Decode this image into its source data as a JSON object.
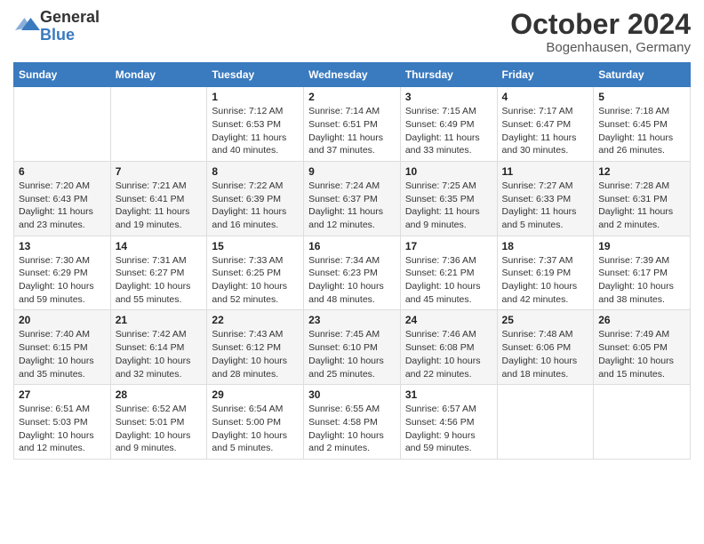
{
  "logo": {
    "general": "General",
    "blue": "Blue"
  },
  "title": "October 2024",
  "subtitle": "Bogenhausen, Germany",
  "days_of_week": [
    "Sunday",
    "Monday",
    "Tuesday",
    "Wednesday",
    "Thursday",
    "Friday",
    "Saturday"
  ],
  "weeks": [
    [
      {
        "day": "",
        "sunrise": "",
        "sunset": "",
        "daylight": ""
      },
      {
        "day": "",
        "sunrise": "",
        "sunset": "",
        "daylight": ""
      },
      {
        "day": "1",
        "sunrise": "Sunrise: 7:12 AM",
        "sunset": "Sunset: 6:53 PM",
        "daylight": "Daylight: 11 hours and 40 minutes."
      },
      {
        "day": "2",
        "sunrise": "Sunrise: 7:14 AM",
        "sunset": "Sunset: 6:51 PM",
        "daylight": "Daylight: 11 hours and 37 minutes."
      },
      {
        "day": "3",
        "sunrise": "Sunrise: 7:15 AM",
        "sunset": "Sunset: 6:49 PM",
        "daylight": "Daylight: 11 hours and 33 minutes."
      },
      {
        "day": "4",
        "sunrise": "Sunrise: 7:17 AM",
        "sunset": "Sunset: 6:47 PM",
        "daylight": "Daylight: 11 hours and 30 minutes."
      },
      {
        "day": "5",
        "sunrise": "Sunrise: 7:18 AM",
        "sunset": "Sunset: 6:45 PM",
        "daylight": "Daylight: 11 hours and 26 minutes."
      }
    ],
    [
      {
        "day": "6",
        "sunrise": "Sunrise: 7:20 AM",
        "sunset": "Sunset: 6:43 PM",
        "daylight": "Daylight: 11 hours and 23 minutes."
      },
      {
        "day": "7",
        "sunrise": "Sunrise: 7:21 AM",
        "sunset": "Sunset: 6:41 PM",
        "daylight": "Daylight: 11 hours and 19 minutes."
      },
      {
        "day": "8",
        "sunrise": "Sunrise: 7:22 AM",
        "sunset": "Sunset: 6:39 PM",
        "daylight": "Daylight: 11 hours and 16 minutes."
      },
      {
        "day": "9",
        "sunrise": "Sunrise: 7:24 AM",
        "sunset": "Sunset: 6:37 PM",
        "daylight": "Daylight: 11 hours and 12 minutes."
      },
      {
        "day": "10",
        "sunrise": "Sunrise: 7:25 AM",
        "sunset": "Sunset: 6:35 PM",
        "daylight": "Daylight: 11 hours and 9 minutes."
      },
      {
        "day": "11",
        "sunrise": "Sunrise: 7:27 AM",
        "sunset": "Sunset: 6:33 PM",
        "daylight": "Daylight: 11 hours and 5 minutes."
      },
      {
        "day": "12",
        "sunrise": "Sunrise: 7:28 AM",
        "sunset": "Sunset: 6:31 PM",
        "daylight": "Daylight: 11 hours and 2 minutes."
      }
    ],
    [
      {
        "day": "13",
        "sunrise": "Sunrise: 7:30 AM",
        "sunset": "Sunset: 6:29 PM",
        "daylight": "Daylight: 10 hours and 59 minutes."
      },
      {
        "day": "14",
        "sunrise": "Sunrise: 7:31 AM",
        "sunset": "Sunset: 6:27 PM",
        "daylight": "Daylight: 10 hours and 55 minutes."
      },
      {
        "day": "15",
        "sunrise": "Sunrise: 7:33 AM",
        "sunset": "Sunset: 6:25 PM",
        "daylight": "Daylight: 10 hours and 52 minutes."
      },
      {
        "day": "16",
        "sunrise": "Sunrise: 7:34 AM",
        "sunset": "Sunset: 6:23 PM",
        "daylight": "Daylight: 10 hours and 48 minutes."
      },
      {
        "day": "17",
        "sunrise": "Sunrise: 7:36 AM",
        "sunset": "Sunset: 6:21 PM",
        "daylight": "Daylight: 10 hours and 45 minutes."
      },
      {
        "day": "18",
        "sunrise": "Sunrise: 7:37 AM",
        "sunset": "Sunset: 6:19 PM",
        "daylight": "Daylight: 10 hours and 42 minutes."
      },
      {
        "day": "19",
        "sunrise": "Sunrise: 7:39 AM",
        "sunset": "Sunset: 6:17 PM",
        "daylight": "Daylight: 10 hours and 38 minutes."
      }
    ],
    [
      {
        "day": "20",
        "sunrise": "Sunrise: 7:40 AM",
        "sunset": "Sunset: 6:15 PM",
        "daylight": "Daylight: 10 hours and 35 minutes."
      },
      {
        "day": "21",
        "sunrise": "Sunrise: 7:42 AM",
        "sunset": "Sunset: 6:14 PM",
        "daylight": "Daylight: 10 hours and 32 minutes."
      },
      {
        "day": "22",
        "sunrise": "Sunrise: 7:43 AM",
        "sunset": "Sunset: 6:12 PM",
        "daylight": "Daylight: 10 hours and 28 minutes."
      },
      {
        "day": "23",
        "sunrise": "Sunrise: 7:45 AM",
        "sunset": "Sunset: 6:10 PM",
        "daylight": "Daylight: 10 hours and 25 minutes."
      },
      {
        "day": "24",
        "sunrise": "Sunrise: 7:46 AM",
        "sunset": "Sunset: 6:08 PM",
        "daylight": "Daylight: 10 hours and 22 minutes."
      },
      {
        "day": "25",
        "sunrise": "Sunrise: 7:48 AM",
        "sunset": "Sunset: 6:06 PM",
        "daylight": "Daylight: 10 hours and 18 minutes."
      },
      {
        "day": "26",
        "sunrise": "Sunrise: 7:49 AM",
        "sunset": "Sunset: 6:05 PM",
        "daylight": "Daylight: 10 hours and 15 minutes."
      }
    ],
    [
      {
        "day": "27",
        "sunrise": "Sunrise: 6:51 AM",
        "sunset": "Sunset: 5:03 PM",
        "daylight": "Daylight: 10 hours and 12 minutes."
      },
      {
        "day": "28",
        "sunrise": "Sunrise: 6:52 AM",
        "sunset": "Sunset: 5:01 PM",
        "daylight": "Daylight: 10 hours and 9 minutes."
      },
      {
        "day": "29",
        "sunrise": "Sunrise: 6:54 AM",
        "sunset": "Sunset: 5:00 PM",
        "daylight": "Daylight: 10 hours and 5 minutes."
      },
      {
        "day": "30",
        "sunrise": "Sunrise: 6:55 AM",
        "sunset": "Sunset: 4:58 PM",
        "daylight": "Daylight: 10 hours and 2 minutes."
      },
      {
        "day": "31",
        "sunrise": "Sunrise: 6:57 AM",
        "sunset": "Sunset: 4:56 PM",
        "daylight": "Daylight: 9 hours and 59 minutes."
      },
      {
        "day": "",
        "sunrise": "",
        "sunset": "",
        "daylight": ""
      },
      {
        "day": "",
        "sunrise": "",
        "sunset": "",
        "daylight": ""
      }
    ]
  ]
}
